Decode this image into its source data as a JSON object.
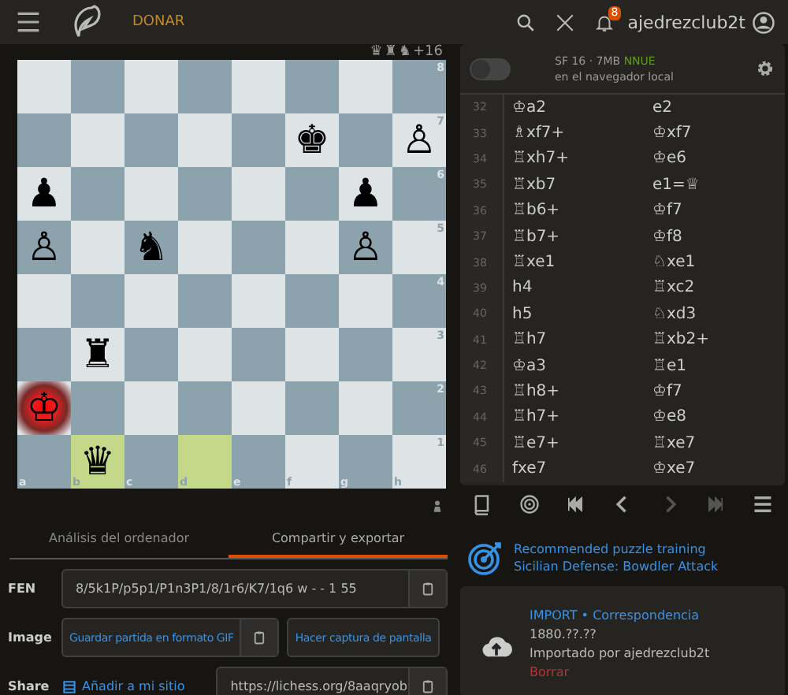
{
  "header": {
    "donate": "DONAR",
    "notifications": "8",
    "username": "ajedrezclub2t"
  },
  "material": {
    "pieces": [
      "♛",
      "♜",
      "♞"
    ],
    "score": "+16"
  },
  "board": {
    "files": [
      "a",
      "b",
      "c",
      "d",
      "e",
      "f",
      "g",
      "h"
    ],
    "ranks": [
      "8",
      "7",
      "6",
      "5",
      "4",
      "3",
      "2",
      "1"
    ],
    "rows": [
      {
        "squares": [
          {
            "highlighted": false,
            "in_check": false
          },
          {
            "highlighted": false,
            "in_check": false
          },
          {
            "highlighted": false,
            "in_check": false
          },
          {
            "highlighted": false,
            "in_check": false
          },
          {
            "highlighted": false,
            "in_check": false
          },
          {
            "highlighted": false,
            "in_check": false
          },
          {
            "highlighted": false,
            "in_check": false
          },
          {
            "highlighted": false,
            "in_check": false
          }
        ]
      },
      {
        "squares": [
          {
            "highlighted": false,
            "in_check": false
          },
          {
            "highlighted": false,
            "in_check": false
          },
          {
            "highlighted": false,
            "in_check": false
          },
          {
            "highlighted": false,
            "in_check": false
          },
          {
            "highlighted": false,
            "in_check": false
          },
          {
            "highlighted": false,
            "in_check": false,
            "piece": "♚"
          },
          {
            "highlighted": false,
            "in_check": false
          },
          {
            "highlighted": false,
            "in_check": false,
            "piece": "♙"
          }
        ]
      },
      {
        "squares": [
          {
            "highlighted": false,
            "in_check": false,
            "piece": "♟"
          },
          {
            "highlighted": false,
            "in_check": false
          },
          {
            "highlighted": false,
            "in_check": false
          },
          {
            "highlighted": false,
            "in_check": false
          },
          {
            "highlighted": false,
            "in_check": false
          },
          {
            "highlighted": false,
            "in_check": false
          },
          {
            "highlighted": false,
            "in_check": false,
            "piece": "♟"
          },
          {
            "highlighted": false,
            "in_check": false
          }
        ]
      },
      {
        "squares": [
          {
            "highlighted": false,
            "in_check": false,
            "piece": "♙"
          },
          {
            "highlighted": false,
            "in_check": false
          },
          {
            "highlighted": false,
            "in_check": false,
            "piece": "♞"
          },
          {
            "highlighted": false,
            "in_check": false
          },
          {
            "highlighted": false,
            "in_check": false
          },
          {
            "highlighted": false,
            "in_check": false
          },
          {
            "highlighted": false,
            "in_check": false,
            "piece": "♙"
          },
          {
            "highlighted": false,
            "in_check": false
          }
        ]
      },
      {
        "squares": [
          {
            "highlighted": false,
            "in_check": false
          },
          {
            "highlighted": false,
            "in_check": false
          },
          {
            "highlighted": false,
            "in_check": false
          },
          {
            "highlighted": false,
            "in_check": false
          },
          {
            "highlighted": false,
            "in_check": false
          },
          {
            "highlighted": false,
            "in_check": false
          },
          {
            "highlighted": false,
            "in_check": false
          },
          {
            "highlighted": false,
            "in_check": false
          }
        ]
      },
      {
        "squares": [
          {
            "highlighted": false,
            "in_check": false
          },
          {
            "highlighted": false,
            "in_check": false,
            "piece": "♜"
          },
          {
            "highlighted": false,
            "in_check": false
          },
          {
            "highlighted": false,
            "in_check": false
          },
          {
            "highlighted": false,
            "in_check": false
          },
          {
            "highlighted": false,
            "in_check": false
          },
          {
            "highlighted": false,
            "in_check": false
          },
          {
            "highlighted": false,
            "in_check": false
          }
        ]
      },
      {
        "squares": [
          {
            "highlighted": false,
            "in_check": true,
            "piece": "♔"
          },
          {
            "highlighted": false,
            "in_check": false
          },
          {
            "highlighted": false,
            "in_check": false
          },
          {
            "highlighted": false,
            "in_check": false
          },
          {
            "highlighted": false,
            "in_check": false
          },
          {
            "highlighted": false,
            "in_check": false
          },
          {
            "highlighted": false,
            "in_check": false
          },
          {
            "highlighted": false,
            "in_check": false
          }
        ]
      },
      {
        "squares": [
          {
            "highlighted": false,
            "in_check": false
          },
          {
            "highlighted": true,
            "in_check": false,
            "piece": "♛"
          },
          {
            "highlighted": false,
            "in_check": false
          },
          {
            "highlighted": true,
            "in_check": false
          },
          {
            "highlighted": false,
            "in_check": false
          },
          {
            "highlighted": false,
            "in_check": false
          },
          {
            "highlighted": false,
            "in_check": false
          },
          {
            "highlighted": false,
            "in_check": false
          }
        ]
      }
    ]
  },
  "engine": {
    "on": false,
    "name": "SF 16 · 7MB",
    "tag": "NNUE",
    "location": "en el navegador local"
  },
  "moves": [
    {
      "number": "32",
      "white": "♔a2",
      "black": "e2"
    },
    {
      "number": "33",
      "white": "♗xf7+",
      "black": "♔xf7"
    },
    {
      "number": "34",
      "white": "♖xh7+",
      "black": "♔e6"
    },
    {
      "number": "35",
      "white": "♖xb7",
      "black": "e1=♕"
    },
    {
      "number": "36",
      "white": "♖b6+",
      "black": "♔f7"
    },
    {
      "number": "37",
      "white": "♖b7+",
      "black": "♔f8"
    },
    {
      "number": "38",
      "white": "♖xe1",
      "black": "♘xe1"
    },
    {
      "number": "39",
      "white": "h4",
      "black": "♖xc2"
    },
    {
      "number": "40",
      "white": "h5",
      "black": "♘xd3"
    },
    {
      "number": "41",
      "white": "♖h7",
      "black": "♖xb2+"
    },
    {
      "number": "42",
      "white": "♔a3",
      "black": "♖e1"
    },
    {
      "number": "43",
      "white": "♖h8+",
      "black": "♔f7"
    },
    {
      "number": "44",
      "white": "♖h7+",
      "black": "♔e8"
    },
    {
      "number": "45",
      "white": "♖e7+",
      "black": "♖xe7"
    },
    {
      "number": "46",
      "white": "fxe7",
      "black": "♔xe7"
    }
  ],
  "controls": [
    {
      "kind": "book",
      "disabled": false
    },
    {
      "kind": "target",
      "disabled": false
    },
    {
      "kind": "first",
      "disabled": false
    },
    {
      "kind": "prev",
      "disabled": false
    },
    {
      "kind": "next",
      "disabled": true
    },
    {
      "kind": "last",
      "disabled": true
    },
    {
      "kind": "menu",
      "disabled": false
    }
  ],
  "tabs": [
    {
      "label": "Análisis del ordenador",
      "selected": false
    },
    {
      "label": "Compartir y exportar",
      "selected": true
    }
  ],
  "fen": {
    "label": "FEN",
    "value": "8/5k1P/p5p1/P1n3P1/8/1r6/K7/1q6 w - - 1 55"
  },
  "image": {
    "label": "Image",
    "gif": "Guardar partida en formato GIF",
    "screenshot": "Hacer captura de pantalla"
  },
  "share": {
    "label": "Share",
    "embed": "Añadir a mi sitio",
    "url": "https://lichess.org/8aaqryob"
  },
  "puzzle": {
    "title": "Recommended puzzle training",
    "opening": "Sicilian Defense: Bowdler Attack"
  },
  "game": {
    "source": "IMPORT",
    "separator": "•",
    "type": "Correspondencia",
    "date": "1880.??.??",
    "imported_by": "Importado por ajedrezclub2t",
    "delete": "Borrar"
  }
}
